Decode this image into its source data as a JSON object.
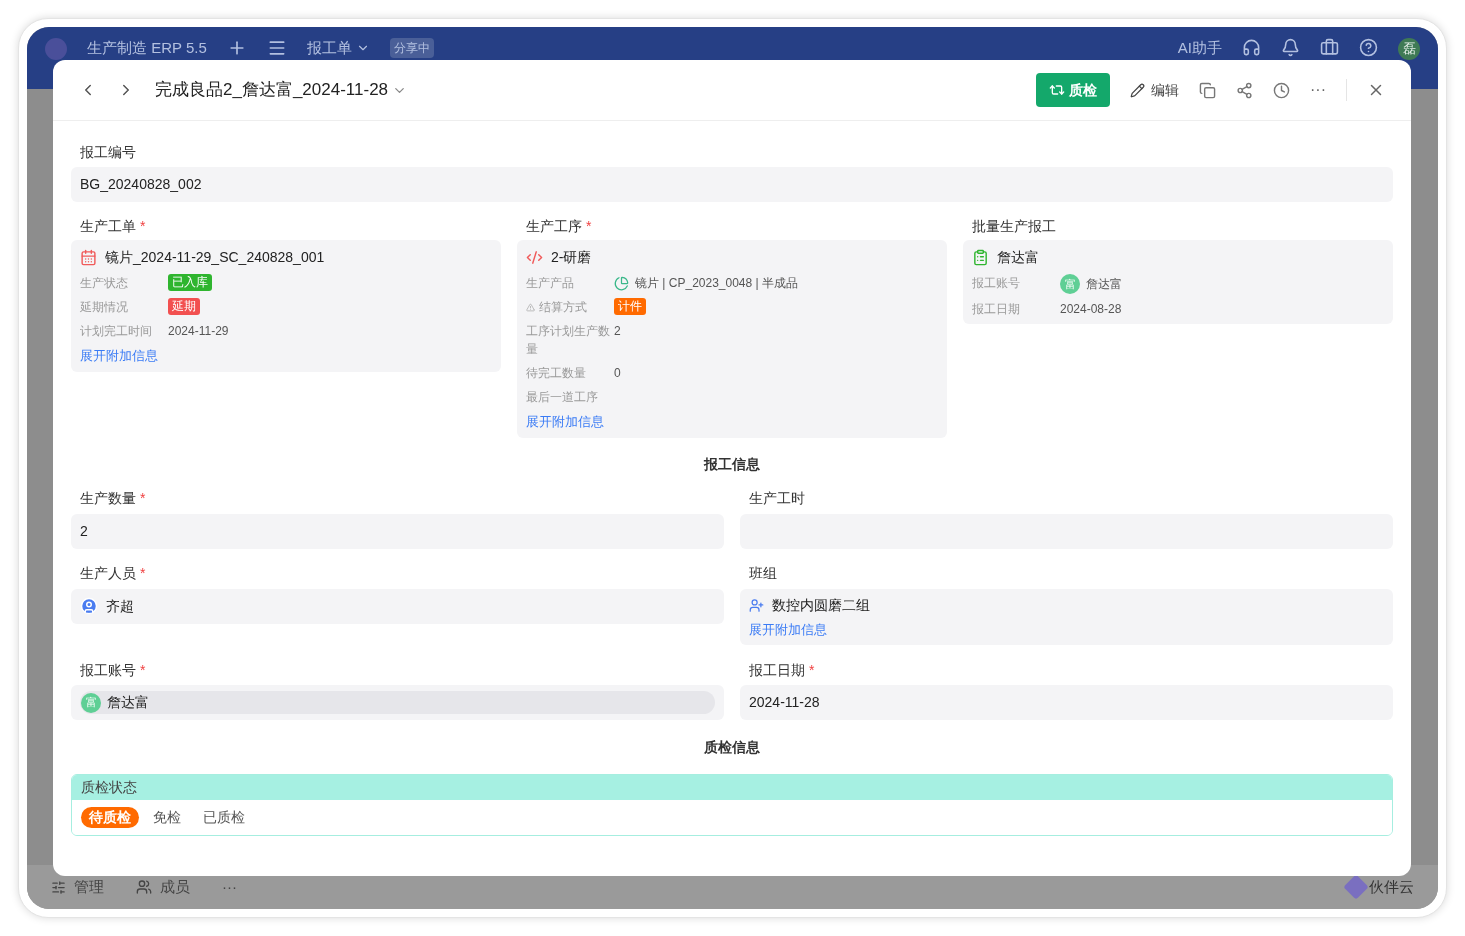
{
  "app_bar": {
    "title": "生产制造 ERP 5.5",
    "view": "报工单",
    "share_badge": "分享中",
    "assistant": "AI助手",
    "avatar": "磊"
  },
  "app_footer": {
    "items": [
      "管理",
      "成员"
    ],
    "more": "···",
    "brand": "伙伴云"
  },
  "modal": {
    "title": "完成良品2_詹达富_2024-11-28",
    "qc_button": "质检",
    "edit_button": "编辑",
    "more": "···"
  },
  "report_no": {
    "label": "报工编号",
    "value": "BG_20240828_002"
  },
  "cards": [
    {
      "label": "生产工单",
      "mark": "*",
      "kind": "order",
      "title": "镜片_2024-11-29_SC_240828_001",
      "rows": [
        {
          "label": "生产状态",
          "warning": false,
          "kind": "tag",
          "value": "已入库",
          "color": "#2fb52f"
        },
        {
          "label": "延期情况",
          "warning": false,
          "kind": "tag",
          "value": "延期",
          "color": "#f25050"
        },
        {
          "label": "计划完工时间",
          "warning": false,
          "kind": "text",
          "value": "2024-11-29"
        }
      ],
      "link": "展开附加信息"
    },
    {
      "label": "生产工序",
      "mark": "*",
      "kind": "process",
      "title": "2-研磨",
      "rows": [
        {
          "label": "生产产品",
          "warning": false,
          "kind": "product",
          "value": "镜片 | CP_2023_0048 | 半成品"
        },
        {
          "label": "结算方式",
          "warning": true,
          "kind": "tag",
          "value": "计件",
          "color": "#ff6a00"
        },
        {
          "label": "工序计划生产数量",
          "warning": false,
          "kind": "text",
          "value": "2"
        },
        {
          "label": "待完工数量",
          "warning": false,
          "kind": "text",
          "value": "0"
        },
        {
          "label": "最后一道工序",
          "warning": false,
          "kind": "text"
        }
      ],
      "link": "展开附加信息"
    },
    {
      "label": "批量生产报工",
      "kind": "batch",
      "title": "詹达富",
      "rows": [
        {
          "label": "报工账号",
          "warning": false,
          "kind": "user",
          "value": "詹达富",
          "avatar": "富"
        },
        {
          "label": "报工日期",
          "warning": false,
          "kind": "text",
          "value": "2024-08-28"
        }
      ]
    }
  ],
  "report_section": "报工信息",
  "fields": [
    {
      "label": "生产数量",
      "mark": "*",
      "kind": "text",
      "value": "2"
    },
    {
      "label": "生产工时",
      "kind": "text"
    },
    {
      "label": "生产人员",
      "mark": "*",
      "kind": "person",
      "value": "齐超"
    },
    {
      "label": "班组",
      "kind": "team",
      "value": "数控内圆磨二组",
      "link": "展开附加信息"
    },
    {
      "label": "报工账号",
      "mark": "*",
      "kind": "user",
      "value": "詹达富",
      "avatar": "富"
    },
    {
      "label": "报工日期",
      "mark": "*",
      "kind": "text",
      "value": "2024-11-28"
    }
  ],
  "qc_section": "质检信息",
  "qc": {
    "label": "质检状态",
    "options": [
      {
        "label": "待质检",
        "selected": true
      },
      {
        "label": "免检",
        "selected": false
      },
      {
        "label": "已质检",
        "selected": false
      }
    ]
  }
}
